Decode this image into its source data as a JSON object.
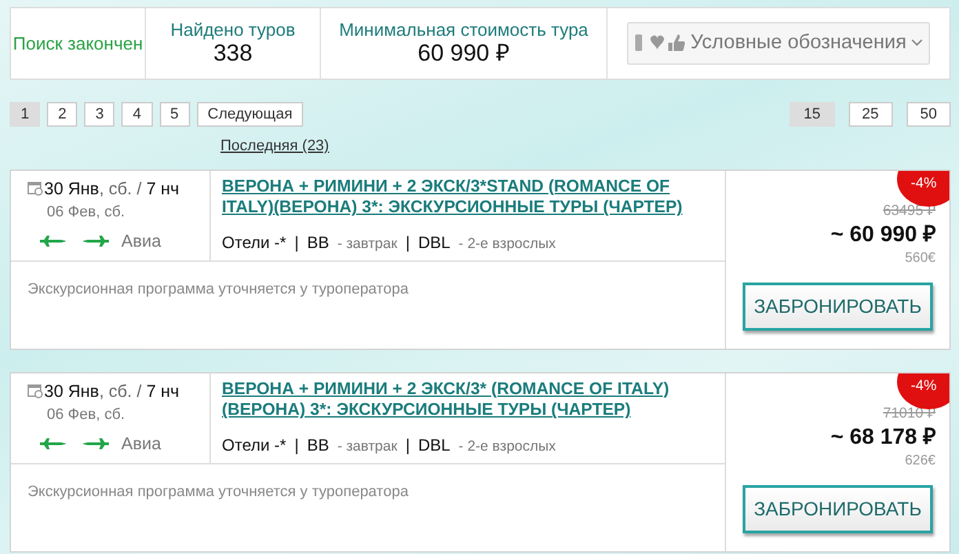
{
  "summary": {
    "status": "Поиск закончен",
    "found_label": "Найдено туров",
    "found_value": "338",
    "min_label": "Минимальная стоимость тура",
    "min_value": "60 990 ₽",
    "legend_button": "Условные обозначения"
  },
  "pagination": {
    "pages": [
      {
        "label": "1",
        "selected": true
      },
      {
        "label": "2",
        "selected": false
      },
      {
        "label": "3",
        "selected": false
      },
      {
        "label": "4",
        "selected": false
      },
      {
        "label": "5",
        "selected": false
      }
    ],
    "next": "Следующая",
    "last": "Последняя (23)",
    "page_sizes": [
      {
        "label": "15",
        "selected": true
      },
      {
        "label": "25",
        "selected": false
      },
      {
        "label": "50",
        "selected": false
      }
    ]
  },
  "tours": [
    {
      "date": "**30 Янв**, сб. / **7 нч**",
      "return_date": "06 Фев, сб.",
      "transport": "Авиа",
      "title": "ВЕРОНА + РИМИНИ + 2 ЭКСК/3*STAND (ROMANCE OF ITALY)(ВЕРОНА) 3*: ЭКСКУРСИОННЫЕ ТУРЫ (ЧАРТЕР)",
      "separator": "|",
      "details": [
        {
          "value": "Отели -*"
        },
        {
          "value": "BB",
          "desc": "- завтрак"
        },
        {
          "value": "DBL",
          "desc": "- 2-е взрослых"
        }
      ],
      "note": "Экскурсионная программа уточняется у туроператора",
      "discount": "-4%",
      "old_price": "63495 ₽",
      "price": "~ 60 990 ₽",
      "price_eur": "560€",
      "book_button": "ЗАБРОНИРОВАТЬ"
    },
    {
      "date": "**30 Янв**, сб. / **7 нч**",
      "return_date": "06 Фев, сб.",
      "transport": "Авиа",
      "title": "ВЕРОНА + РИМИНИ + 2 ЭКСК/3* (ROMANCE OF ITALY) (ВЕРОНА) 3*: ЭКСКУРСИОННЫЕ ТУРЫ (ЧАРТЕР)",
      "separator": "|",
      "details": [
        {
          "value": "Отели -*"
        },
        {
          "value": "BB",
          "desc": "- завтрак"
        },
        {
          "value": "DBL",
          "desc": "- 2-е взрослых"
        }
      ],
      "note": "Экскурсионная программа уточняется у туроператора",
      "discount": "-4%",
      "old_price": "71010 ₽",
      "price": "~ 68 178 ₽",
      "price_eur": "626€",
      "book_button": "ЗАБРОНИРОВАТЬ"
    }
  ]
}
